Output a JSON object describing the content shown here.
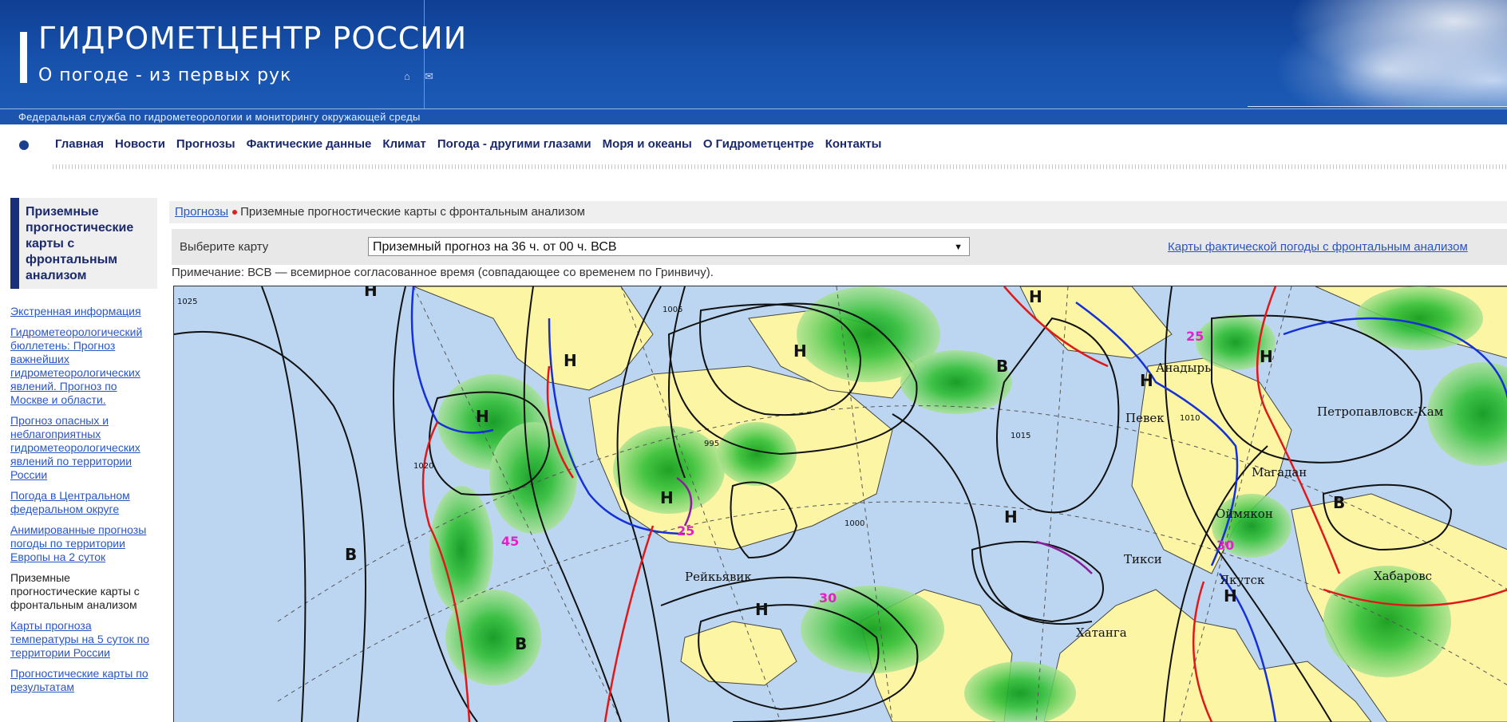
{
  "header": {
    "title": "ГИДРОМЕТЦЕНТР РОССИИ",
    "slogan": "О погоде - из первых рук",
    "subtitle": "Федеральная служба по гидрометеорологии и мониторингу окружающей среды",
    "icons": [
      "home-icon",
      "mail-icon"
    ]
  },
  "nav": {
    "items": [
      "Главная",
      "Новости",
      "Прогнозы",
      "Фактические данные",
      "Климат",
      "Погода - другими глазами",
      "Моря и океаны",
      "О Гидрометцентре",
      "Контакты"
    ]
  },
  "sidebar": {
    "title": "Приземные прогностические карты с фронтальным анализом",
    "items": [
      "Экстренная информация",
      "Гидрометеорологический бюллетень: Прогноз важнейших гидрометеорологических явлений. Прогноз по Москве и области.",
      "Прогноз опасных и неблагоприятных гидрометеорологических явлений по территории России",
      "Погода в Центральном федеральном округе",
      "Анимированные прогнозы погоды по территории Европы на 2 суток",
      "Приземные прогностические карты с фронтальным анализом",
      "Карты прогноза температуры на 5 суток по территории России",
      "Прогностические карты по результатам"
    ]
  },
  "breadcrumb": {
    "parent": "Прогнозы",
    "current": "Приземные прогностические карты с фронтальным анализом"
  },
  "map_select": {
    "label": "Выберите карту",
    "selected": "Приземный прогноз на 36 ч. от 00 ч. ВСВ",
    "actual_link": "Карты фактической погоды с фронтальным анализом"
  },
  "note": "Примечание: ВСВ — всемирное согласованное время (совпадающее со временем по Гринвичу).",
  "map": {
    "cities": [
      "Рейкьявик",
      "Певек",
      "Анадырь",
      "Магадан",
      "Оймякон",
      "Тикси",
      "Якутск",
      "Хатанга",
      "Петропавловск-Кам",
      "Хабаровс"
    ],
    "pressure_centers": [
      "Н",
      "В"
    ],
    "isobars": [
      "1025",
      "1015",
      "1005",
      "995",
      "1020",
      "1010",
      "1000"
    ],
    "wind_speeds": [
      "45",
      "25",
      "30",
      "25",
      "30"
    ],
    "colors": {
      "sea": "#bcd6f2",
      "land": "#fbf5a4",
      "precip": "#3fbf3f",
      "cold_front": "#1530d8",
      "warm_front": "#e01818",
      "occluded_front": "#8a1f9a"
    }
  }
}
